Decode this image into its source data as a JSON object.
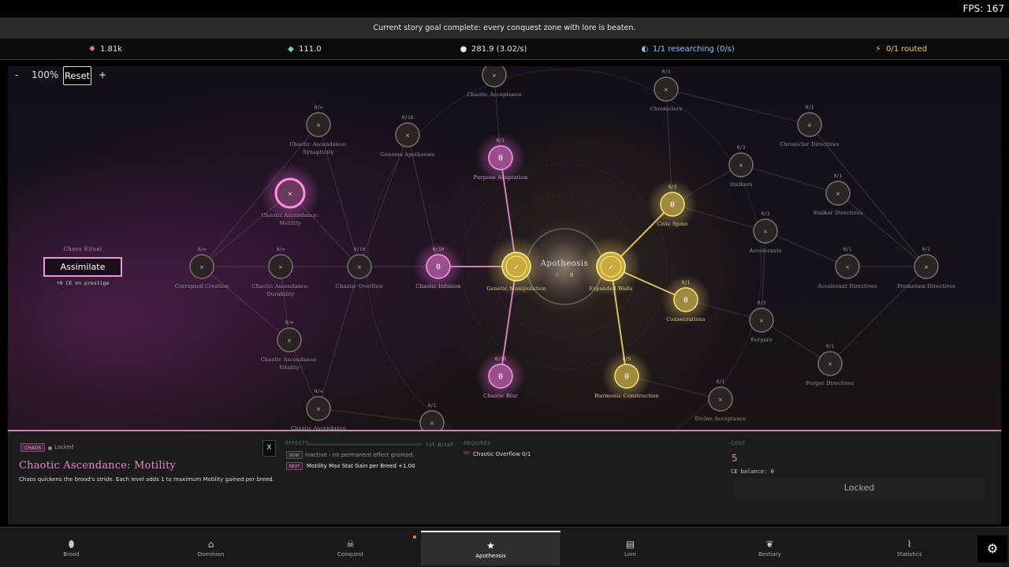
{
  "fps": "FPS: 167",
  "goal_banner": "Current story goal complete: every conquest zone with lore is beaten.",
  "resources": {
    "biomass": {
      "value": "1.81k",
      "icon": "burst-icon",
      "color": "#ff7a8a"
    },
    "gems": {
      "value": "111.0",
      "icon": "gem-icon",
      "color": "#6fe0a0"
    },
    "essence": {
      "value": "281.9 (3.02/s)",
      "icon": "flame-icon",
      "color": "#ffffff"
    },
    "research": {
      "value": "1/1 researching (0/s)",
      "icon": "research-icon",
      "color": "#8fc1ff"
    },
    "routed": {
      "value": "0/1 routed",
      "icon": "bolt-icon",
      "color": "#f0d060"
    }
  },
  "zoom": {
    "minus": "-",
    "level": "100%",
    "reset": "Reset",
    "plus": "+"
  },
  "ritual": {
    "title": "Chaos Ritual",
    "button": "Assimilate",
    "note": "+0 CE on prestige"
  },
  "tree": {
    "center": {
      "title": "Apotheosis",
      "left_val": "0",
      "right_val": "0"
    },
    "nodes": [
      {
        "label": "Chaotic Acceptance",
        "level": "",
        "glyph": "×",
        "state": "locked"
      },
      {
        "label": "Chroniclers",
        "level": "0/3",
        "glyph": "×",
        "state": "locked"
      },
      {
        "label": "Chronicler Directives",
        "level": "0/1",
        "glyph": "×",
        "state": "locked"
      },
      {
        "label": "Chaotic Ascendance: Synapticity",
        "level": "0/∞",
        "glyph": "×",
        "state": "locked"
      },
      {
        "label": "Genome Apotheosis",
        "level": "0/10",
        "glyph": "×",
        "state": "locked"
      },
      {
        "label": "Purpose Adaptation",
        "level": "0/1",
        "glyph": "0",
        "state": "pink"
      },
      {
        "label": "Stalkers",
        "level": "0/3",
        "glyph": "×",
        "state": "locked"
      },
      {
        "label": "Stalker Directives",
        "level": "0/1",
        "glyph": "×",
        "state": "locked"
      },
      {
        "label": "Chaotic Ascendance: Motility",
        "level": "",
        "glyph": "×",
        "state": "selected"
      },
      {
        "label": "Civic Spine",
        "level": "0/3",
        "glyph": "0",
        "state": "gold"
      },
      {
        "label": "Accelerants",
        "level": "0/3",
        "glyph": "×",
        "state": "locked"
      },
      {
        "label": "Corrupted Creation",
        "level": "0/∞",
        "glyph": "×",
        "state": "locked"
      },
      {
        "label": "Chaotic Ascendance: Durability",
        "level": "0/∞",
        "glyph": "×",
        "state": "locked"
      },
      {
        "label": "Chaotic Overflow",
        "level": "0/10",
        "glyph": "×",
        "state": "locked"
      },
      {
        "label": "Chaotic Infusion",
        "level": "0/10",
        "glyph": "0",
        "state": "pink"
      },
      {
        "label": "Genetic Manipulation",
        "level": "",
        "glyph": "✓",
        "state": "gold-big"
      },
      {
        "label": "Expanded Walls",
        "level": "",
        "glyph": "✓",
        "state": "gold-big"
      },
      {
        "label": "Accelerant Directives",
        "level": "0/1",
        "glyph": "×",
        "state": "locked"
      },
      {
        "label": "Promotion Directives",
        "level": "0/1",
        "glyph": "×",
        "state": "locked"
      },
      {
        "label": "Consecrations",
        "level": "0/1",
        "glyph": "0",
        "state": "gold"
      },
      {
        "label": "Forgers",
        "level": "0/3",
        "glyph": "×",
        "state": "locked"
      },
      {
        "label": "Chaotic Ascendance: Vitality",
        "level": "0/∞",
        "glyph": "×",
        "state": "locked"
      },
      {
        "label": "Forger Directives",
        "level": "0/1",
        "glyph": "×",
        "state": "locked"
      },
      {
        "label": "Chaotic Blur",
        "level": "0/10",
        "glyph": "0",
        "state": "pink"
      },
      {
        "label": "Harmonic Construction",
        "level": "0/5",
        "glyph": "0",
        "state": "gold"
      },
      {
        "label": "Divine Acceptance",
        "level": "0/1",
        "glyph": "×",
        "state": "locked"
      },
      {
        "label": "Chaotic Ascendance",
        "level": "0/∞",
        "glyph": "×",
        "state": "locked"
      },
      {
        "label": "",
        "level": "0/1",
        "glyph": "×",
        "state": "locked"
      }
    ]
  },
  "detail": {
    "tag": "CHAOS",
    "lock_status": "Locked",
    "title": "Chaotic Ascendance: Motility",
    "description": "Chaos quickens the brood's stride. Each level adds 1 to maximum Motility gained per breed.",
    "close": "X",
    "effects_head": "EFFECTS",
    "level": "lvl 0/inf",
    "now_tag": "NOW",
    "now_text": "Inactive - no permanent effect granted.",
    "next_tag": "NEXT",
    "next_text": "Motility Max Stat Gain per Breed +1.00",
    "requires_head": "REQUIRES",
    "req_tag": "NO",
    "req_text": "Chaotic Overflow  0/1",
    "cost_head": "COST",
    "cost_value": "5",
    "balance": "CE balance: 0",
    "action": "Locked"
  },
  "nav": [
    {
      "label": "Brood",
      "icon": "egg-icon"
    },
    {
      "label": "Dominion",
      "icon": "home-icon"
    },
    {
      "label": "Conquest",
      "icon": "skull-icon"
    },
    {
      "label": "Apotheosis",
      "icon": "star-icon"
    },
    {
      "label": "Lore",
      "icon": "book-icon"
    },
    {
      "label": "Bestiary",
      "icon": "paw-icon"
    },
    {
      "label": "Statistics",
      "icon": "chart-icon"
    }
  ],
  "active_tab": "Apotheosis",
  "colors": {
    "pink": "#e58ad0",
    "gold": "#f0d060",
    "locked": "#8a8a8a",
    "bg": "#141019"
  }
}
